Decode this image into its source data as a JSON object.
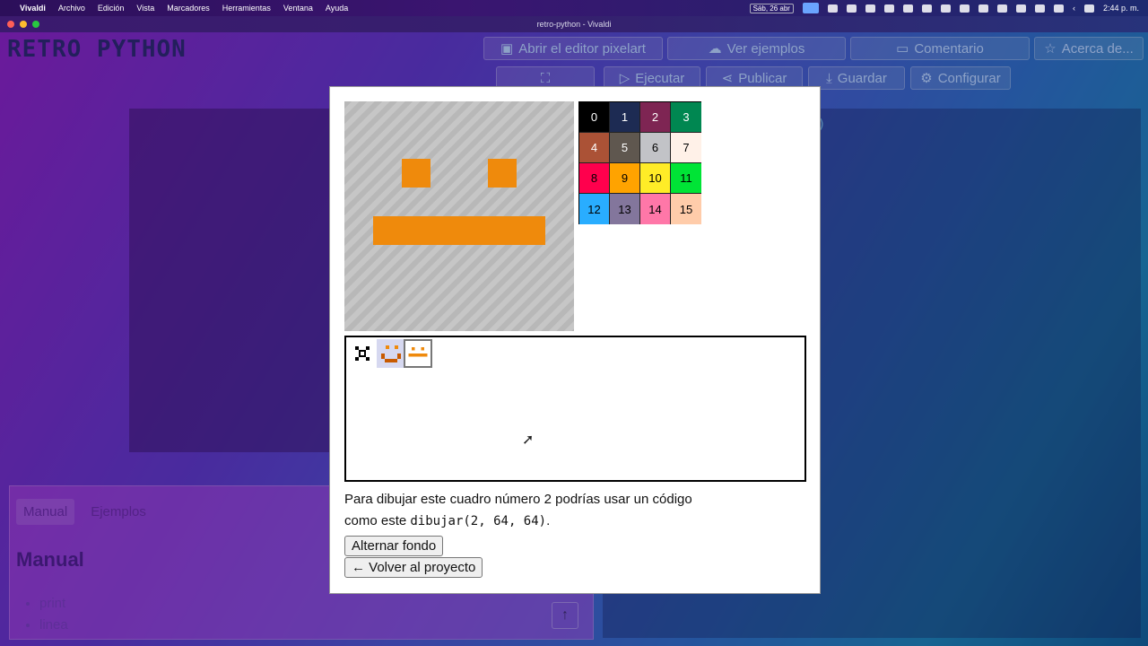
{
  "menubar": {
    "app": "Vivaldi",
    "items": [
      "Archivo",
      "Edición",
      "Vista",
      "Marcadores",
      "Herramientas",
      "Ventana",
      "Ayuda"
    ],
    "date": "Sáb, 26 abr",
    "time": "2:44 p. m."
  },
  "window": {
    "title": "retro-python - Vivaldi"
  },
  "app": {
    "logo": "RETRO PYTHON",
    "top_buttons": [
      "Abrir el editor pixelart",
      "Ver ejemplos",
      "Comentario",
      "Acerca de..."
    ],
    "toolbar_buttons": [
      "Ejecutar",
      "Publicar",
      "Guardar",
      "Configurar"
    ],
    "editor_code_snippet": ")",
    "tabs": [
      "Manual",
      "Ejemplos"
    ],
    "manual_title": "Manual",
    "manual_items": [
      "print",
      "linea"
    ]
  },
  "modal": {
    "palette": [
      {
        "label": "0",
        "color": "#000000",
        "text": "#ffffff"
      },
      {
        "label": "1",
        "color": "#1d2b53",
        "text": "#ffffff"
      },
      {
        "label": "2",
        "color": "#7e2553",
        "text": "#ffffff"
      },
      {
        "label": "3",
        "color": "#008751",
        "text": "#ffffff"
      },
      {
        "label": "4",
        "color": "#ab5236",
        "text": "#ffffff"
      },
      {
        "label": "5",
        "color": "#5f574f",
        "text": "#ffffff"
      },
      {
        "label": "6",
        "color": "#c2c3c7",
        "text": "#000000"
      },
      {
        "label": "7",
        "color": "#fff1e8",
        "text": "#000000"
      },
      {
        "label": "8",
        "color": "#ff004d",
        "text": "#000000"
      },
      {
        "label": "9",
        "color": "#ffa300",
        "text": "#000000"
      },
      {
        "label": "10",
        "color": "#ffec27",
        "text": "#000000"
      },
      {
        "label": "11",
        "color": "#00e436",
        "text": "#000000"
      },
      {
        "label": "12",
        "color": "#29adff",
        "text": "#000000"
      },
      {
        "label": "13",
        "color": "#83769c",
        "text": "#000000"
      },
      {
        "label": "14",
        "color": "#ff77a8",
        "text": "#000000"
      },
      {
        "label": "15",
        "color": "#ffccaa",
        "text": "#000000"
      }
    ],
    "description_prefix": "Para dibujar este cuadro número 2 podrías usar un código como este ",
    "description_code": "dibujar(2, 64, 64)",
    "description_suffix": ".",
    "toggle_background_label": "Alternar fondo",
    "back_label": "← Volver al proyecto"
  }
}
